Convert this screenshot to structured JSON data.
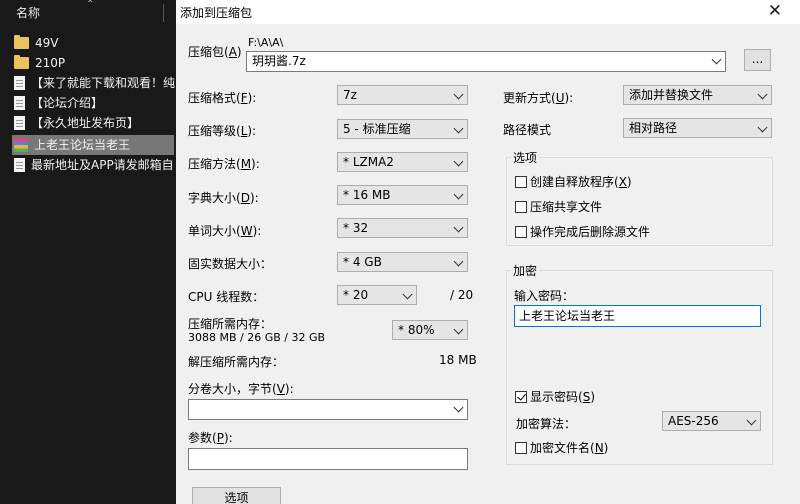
{
  "explorer": {
    "column_header": "名称",
    "items": [
      {
        "icon": "folder-icon",
        "label": "49V"
      },
      {
        "icon": "folder-icon",
        "label": "210P"
      },
      {
        "icon": "document-icon",
        "label": "【来了就能下载和观看！纯"
      },
      {
        "icon": "document-icon",
        "label": "【论坛介绍】"
      },
      {
        "icon": "document-icon",
        "label": "【永久地址发布页】"
      },
      {
        "icon": "rar-archive-icon",
        "label": "上老王论坛当老王",
        "selected": true
      },
      {
        "icon": "document-icon",
        "label": "最新地址及APP请发邮箱自"
      }
    ]
  },
  "dialog": {
    "title": "添加到压缩包",
    "close_icon": "close-icon",
    "archive": {
      "label": "压缩包(",
      "hotkey": "A",
      "label_end": ")",
      "path": "F:\\A\\A\\",
      "name": "玥玥酱.7z",
      "browse": "..."
    },
    "format": {
      "label": "压缩格式(",
      "hotkey": "F",
      "label_end": "):",
      "value": "7z"
    },
    "level": {
      "label": "压缩等级(",
      "hotkey": "L",
      "label_end": "):",
      "value": "5 - 标准压缩"
    },
    "method": {
      "label": "压缩方法(",
      "hotkey": "M",
      "label_end": "):",
      "value": "* LZMA2"
    },
    "dict": {
      "label": "字典大小(",
      "hotkey": "D",
      "label_end": "):",
      "value": "* 16 MB"
    },
    "word": {
      "label": "单词大小(",
      "hotkey": "W",
      "label_end": "):",
      "value": "* 32"
    },
    "solid": {
      "label": "固实数据大小：",
      "value": "* 4 GB"
    },
    "threads": {
      "label": "CPU 线程数：",
      "value": "* 20",
      "max": "/ 20"
    },
    "memory": {
      "label": "压缩所需内存：",
      "detail": "3088 MB / 26 GB / 32 GB",
      "value": "* 80%"
    },
    "decompress": {
      "label": "解压缩所需内存：",
      "value": "18 MB"
    },
    "volume": {
      "label": "分卷大小，字节(",
      "hotkey": "V",
      "label_end": "):",
      "value": ""
    },
    "params": {
      "label": "参数(",
      "hotkey": "P",
      "label_end": "):",
      "value": ""
    },
    "options_button": "选项",
    "update": {
      "label": "更新方式(",
      "hotkey": "U",
      "label_end": "):",
      "value": "添加并替换文件"
    },
    "pathmode": {
      "label": "路径模式",
      "value": "相对路径"
    },
    "options_group": {
      "title": "选项",
      "sfx": {
        "label": "创建自释放程序(",
        "hotkey": "X",
        "label_end": ")",
        "checked": false
      },
      "shared": {
        "label": "压缩共享文件",
        "checked": false
      },
      "delete": {
        "label": "操作完成后删除源文件",
        "checked": false
      }
    },
    "encryption": {
      "title": "加密",
      "password_label": "输入密码：",
      "password": "上老王论坛当老王",
      "show_password": {
        "label": "显示密码(",
        "hotkey": "S",
        "label_end": ")",
        "checked": true
      },
      "method_label": "加密算法：",
      "method": "AES-256",
      "encrypt_names": {
        "label": "加密文件名(",
        "hotkey": "N",
        "label_end": ")",
        "checked": false
      }
    }
  }
}
